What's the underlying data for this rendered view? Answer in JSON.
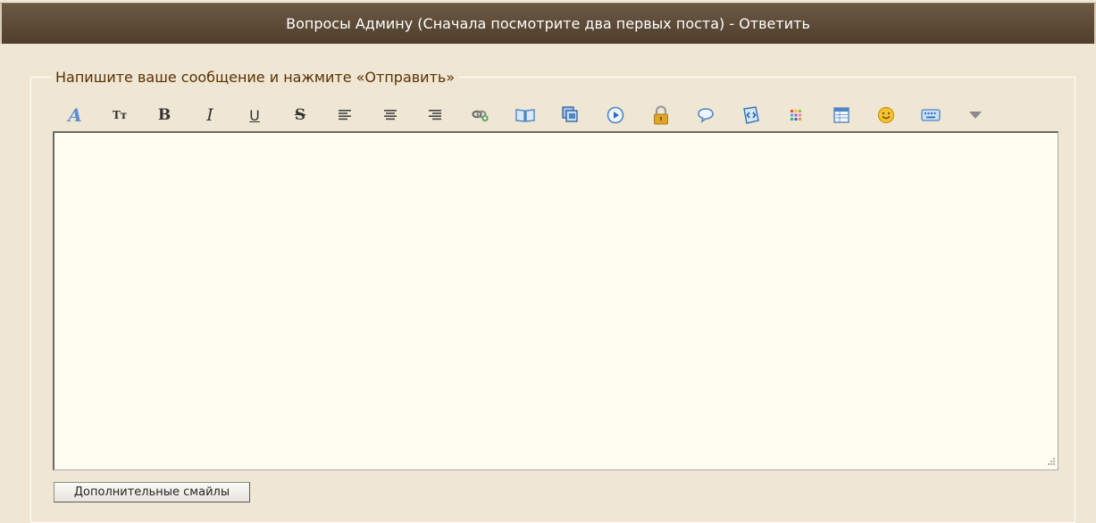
{
  "header": {
    "title": "Вопросы Админу (Сначала посмотрите два первых поста) - Ответить"
  },
  "form": {
    "legend": "Напишите ваше сообщение и нажмите «Отправить»"
  },
  "toolbar": {
    "font_face_glyph": "A",
    "font_size_glyph": "Tт",
    "bold_glyph": "B",
    "italic_glyph": "I",
    "underline_glyph": "U",
    "strike_glyph": "S"
  },
  "editor": {
    "value": ""
  },
  "buttons": {
    "more_smiles": "Дополнительные смайлы"
  },
  "colors": {
    "header_bg": "#5c4a36",
    "page_bg": "#efe6d4",
    "legend_text": "#5a3200",
    "editor_bg": "#fffcf1",
    "icon_blue": "#4f86c6",
    "icon_gold": "#e0a428"
  }
}
